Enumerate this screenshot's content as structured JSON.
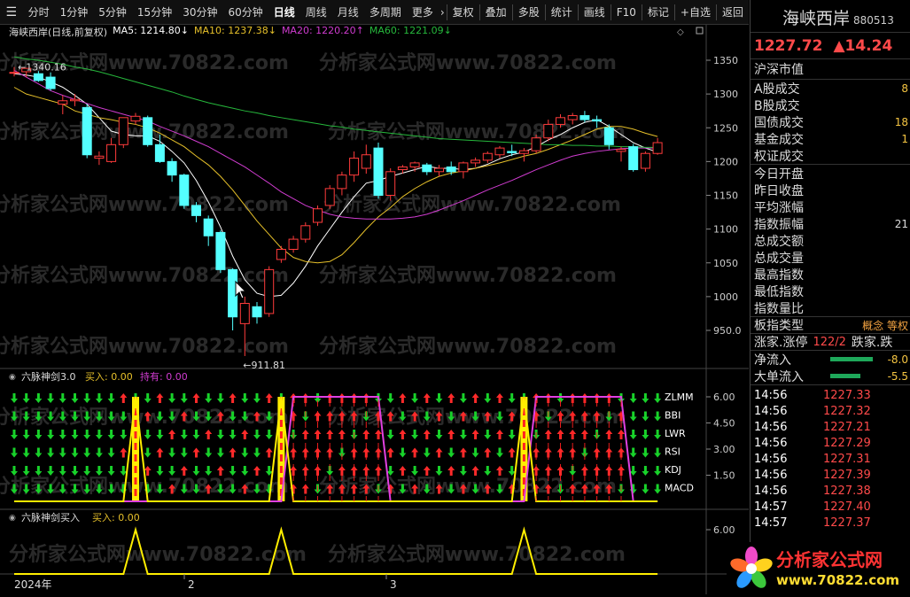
{
  "toolbar": {
    "menu_icon": "menu-icon",
    "periods": [
      "分时",
      "1分钟",
      "5分钟",
      "15分钟",
      "30分钟",
      "60分钟",
      "日线",
      "周线",
      "月线",
      "多周期",
      "更多"
    ],
    "active_period": "日线",
    "more_arrow": "›",
    "tools": [
      "复权",
      "叠加",
      "多股",
      "统计",
      "画线",
      "F10",
      "标记",
      "+自选",
      "返回"
    ]
  },
  "chart": {
    "title": "海峡西岸(日线,前复权)",
    "ma": [
      {
        "label": "MA5: 1214.80",
        "arrow": "↓",
        "color": "#ffffff"
      },
      {
        "label": "MA10: 1237.38",
        "arrow": "↓",
        "color": "#e6c02a"
      },
      {
        "label": "MA20: 1220.20",
        "arrow": "↑",
        "color": "#d03cd0"
      },
      {
        "label": "MA60: 1221.09",
        "arrow": "↓",
        "color": "#26b83c"
      }
    ],
    "high_mark": "1340.16",
    "low_mark": "911.81",
    "watermark": "分析家公式网www.70822.com",
    "y_ticks": [
      "1350",
      "1300",
      "1250",
      "1200",
      "1150",
      "1100",
      "1050",
      "1000",
      "950.0"
    ],
    "candles": [
      {
        "o": 1332,
        "h": 1340,
        "c": 1332,
        "l": 1326
      },
      {
        "o": 1333,
        "h": 1337,
        "c": 1338,
        "l": 1325
      },
      {
        "o": 1330,
        "h": 1334,
        "c": 1320,
        "l": 1318
      },
      {
        "o": 1325,
        "h": 1332,
        "c": 1308,
        "l": 1305
      },
      {
        "o": 1285,
        "h": 1298,
        "c": 1290,
        "l": 1270
      },
      {
        "o": 1290,
        "h": 1300,
        "c": 1292,
        "l": 1282
      },
      {
        "o": 1280,
        "h": 1285,
        "c": 1210,
        "l": 1205
      },
      {
        "o": 1205,
        "h": 1215,
        "c": 1208,
        "l": 1195
      },
      {
        "o": 1200,
        "h": 1235,
        "c": 1225,
        "l": 1198
      },
      {
        "o": 1225,
        "h": 1260,
        "c": 1265,
        "l": 1220
      },
      {
        "o": 1260,
        "h": 1272,
        "c": 1267,
        "l": 1255
      },
      {
        "o": 1265,
        "h": 1268,
        "c": 1225,
        "l": 1222
      },
      {
        "o": 1225,
        "h": 1240,
        "c": 1200,
        "l": 1198
      },
      {
        "o": 1200,
        "h": 1205,
        "c": 1180,
        "l": 1170
      },
      {
        "o": 1180,
        "h": 1182,
        "c": 1135,
        "l": 1130
      },
      {
        "o": 1135,
        "h": 1140,
        "c": 1120,
        "l": 1110
      },
      {
        "o": 1115,
        "h": 1120,
        "c": 1090,
        "l": 1075
      },
      {
        "o": 1095,
        "h": 1098,
        "c": 1040,
        "l": 1035
      },
      {
        "o": 1040,
        "h": 1042,
        "c": 970,
        "l": 950
      },
      {
        "o": 960,
        "h": 1000,
        "c": 990,
        "l": 912
      },
      {
        "o": 985,
        "h": 992,
        "c": 970,
        "l": 960
      },
      {
        "o": 975,
        "h": 1045,
        "c": 1040,
        "l": 970
      },
      {
        "o": 1055,
        "h": 1075,
        "c": 1070,
        "l": 1050
      },
      {
        "o": 1070,
        "h": 1090,
        "c": 1085,
        "l": 1065
      },
      {
        "o": 1085,
        "h": 1110,
        "c": 1105,
        "l": 1080
      },
      {
        "o": 1110,
        "h": 1135,
        "c": 1130,
        "l": 1105
      },
      {
        "o": 1135,
        "h": 1165,
        "c": 1160,
        "l": 1130
      },
      {
        "o": 1160,
        "h": 1185,
        "c": 1180,
        "l": 1150
      },
      {
        "o": 1180,
        "h": 1215,
        "c": 1205,
        "l": 1170
      },
      {
        "o": 1190,
        "h": 1225,
        "c": 1210,
        "l": 1182
      },
      {
        "o": 1220,
        "h": 1228,
        "c": 1150,
        "l": 1145
      },
      {
        "o": 1150,
        "h": 1190,
        "c": 1185,
        "l": 1142
      },
      {
        "o": 1188,
        "h": 1195,
        "c": 1192,
        "l": 1182
      },
      {
        "o": 1192,
        "h": 1200,
        "c": 1198,
        "l": 1185
      },
      {
        "o": 1195,
        "h": 1198,
        "c": 1185,
        "l": 1180
      },
      {
        "o": 1185,
        "h": 1195,
        "c": 1190,
        "l": 1178
      },
      {
        "o": 1192,
        "h": 1200,
        "c": 1185,
        "l": 1180
      },
      {
        "o": 1185,
        "h": 1200,
        "c": 1198,
        "l": 1175
      },
      {
        "o": 1198,
        "h": 1206,
        "c": 1202,
        "l": 1192
      },
      {
        "o": 1202,
        "h": 1215,
        "c": 1212,
        "l": 1198
      },
      {
        "o": 1210,
        "h": 1223,
        "c": 1220,
        "l": 1205
      },
      {
        "o": 1215,
        "h": 1225,
        "c": 1213,
        "l": 1208
      },
      {
        "o": 1212,
        "h": 1220,
        "c": 1216,
        "l": 1200
      },
      {
        "o": 1216,
        "h": 1240,
        "c": 1235,
        "l": 1212
      },
      {
        "o": 1235,
        "h": 1262,
        "c": 1255,
        "l": 1230
      },
      {
        "o": 1255,
        "h": 1270,
        "c": 1265,
        "l": 1250
      },
      {
        "o": 1262,
        "h": 1272,
        "c": 1268,
        "l": 1255
      },
      {
        "o": 1268,
        "h": 1275,
        "c": 1262,
        "l": 1258
      },
      {
        "o": 1262,
        "h": 1268,
        "c": 1260,
        "l": 1250
      },
      {
        "o": 1250,
        "h": 1255,
        "c": 1225,
        "l": 1218
      },
      {
        "o": 1215,
        "h": 1222,
        "c": 1218,
        "l": 1200
      },
      {
        "o": 1222,
        "h": 1226,
        "c": 1188,
        "l": 1185
      },
      {
        "o": 1190,
        "h": 1215,
        "c": 1212,
        "l": 1185
      },
      {
        "o": 1212,
        "h": 1235,
        "c": 1228,
        "l": 1210
      }
    ],
    "ma_lines": {
      "ma5": [
        1330,
        1328,
        1325,
        1318,
        1310,
        1298,
        1285,
        1265,
        1245,
        1240,
        1238,
        1238,
        1230,
        1215,
        1198,
        1172,
        1140,
        1103,
        1060,
        1025,
        1005,
        1000,
        1002,
        1020,
        1045,
        1075,
        1100,
        1125,
        1148,
        1168,
        1172,
        1178,
        1183,
        1188,
        1193,
        1190,
        1190,
        1188,
        1190,
        1196,
        1204,
        1210,
        1214,
        1222,
        1232,
        1240,
        1250,
        1258,
        1262,
        1252,
        1240,
        1228,
        1220,
        1214
      ],
      "ma10": [
        1310,
        1300,
        1295,
        1290,
        1285,
        1275,
        1270,
        1265,
        1262,
        1258,
        1255,
        1250,
        1242,
        1232,
        1222,
        1208,
        1195,
        1178,
        1158,
        1135,
        1112,
        1092,
        1072,
        1058,
        1052,
        1050,
        1052,
        1062,
        1080,
        1100,
        1118,
        1132,
        1148,
        1160,
        1170,
        1178,
        1183,
        1186,
        1190,
        1194,
        1198,
        1203,
        1208,
        1212,
        1218,
        1225,
        1232,
        1240,
        1248,
        1252,
        1252,
        1248,
        1242,
        1237
      ],
      "ma20": [
        1335,
        1325,
        1315,
        1305,
        1298,
        1292,
        1286,
        1280,
        1275,
        1270,
        1265,
        1260,
        1252,
        1245,
        1238,
        1230,
        1222,
        1212,
        1202,
        1192,
        1180,
        1168,
        1155,
        1145,
        1135,
        1128,
        1122,
        1118,
        1116,
        1115,
        1115,
        1115,
        1116,
        1118,
        1122,
        1128,
        1135,
        1142,
        1150,
        1158,
        1165,
        1172,
        1180,
        1188,
        1195,
        1202,
        1208,
        1212,
        1215,
        1217,
        1219,
        1220,
        1220,
        1220
      ],
      "ma60": [
        1355,
        1352,
        1350,
        1347,
        1344,
        1340,
        1337,
        1333,
        1328,
        1323,
        1318,
        1313,
        1308,
        1303,
        1297,
        1292,
        1287,
        1283,
        1279,
        1275,
        1272,
        1268,
        1265,
        1262,
        1259,
        1256,
        1253,
        1251,
        1248,
        1246,
        1244,
        1242,
        1240,
        1238,
        1236,
        1234,
        1233,
        1232,
        1231,
        1230,
        1229,
        1228,
        1227,
        1226,
        1225,
        1225,
        1224,
        1224,
        1223,
        1223,
        1222,
        1222,
        1221,
        1221
      ]
    }
  },
  "indicator1": {
    "title": "六脉神剑3.0",
    "buy_label": "买入: 0.00",
    "hold_label": "持有: 0.00",
    "rows": [
      "ZLMM",
      "BBI",
      "LWR",
      "RSI",
      "KDJ",
      "MACD"
    ],
    "y_ticks": [
      "6.00",
      "4.50",
      "3.00",
      "1.50"
    ],
    "hold_level": [
      0,
      0,
      0,
      0,
      0,
      0,
      0,
      0,
      0,
      0,
      0,
      0,
      0,
      0,
      0,
      0,
      0,
      0,
      0,
      0,
      0,
      0,
      0,
      6,
      6,
      6,
      6,
      6,
      6,
      6,
      6,
      0,
      0,
      0,
      0,
      0,
      0,
      0,
      0,
      0,
      0,
      0,
      0,
      6,
      6,
      6,
      6,
      6,
      6,
      6,
      6,
      0,
      0,
      0
    ],
    "spike_index": [
      10,
      22,
      42
    ]
  },
  "indicator2": {
    "title": "六脉神剑买入",
    "buy_label": "买入: 0.00",
    "y_ticks": [
      "6.00"
    ],
    "spike_index": [
      10,
      22,
      42
    ]
  },
  "xaxis": {
    "labels": [
      "2024年",
      "2",
      "3"
    ]
  },
  "sidebar": {
    "name": "海峡西岸",
    "code": "880513",
    "price": "1227.72",
    "change": "▲14.24",
    "section": "沪深市值",
    "rows": [
      {
        "k": "A股成交",
        "v": "8"
      },
      {
        "k": "B股成交",
        "v": ""
      },
      {
        "k": "国债成交",
        "v": "18"
      },
      {
        "k": "基金成交",
        "v": "1"
      },
      {
        "k": "权证成交",
        "v": ""
      }
    ],
    "rows2": [
      {
        "k": "今日开盘",
        "v": ""
      },
      {
        "k": "昨日收盘",
        "v": ""
      },
      {
        "k": "平均涨幅",
        "v": ""
      },
      {
        "k": "指数振幅",
        "v": "21"
      },
      {
        "k": "总成交额",
        "v": ""
      },
      {
        "k": "总成交量",
        "v": ""
      },
      {
        "k": "最高指数",
        "v": ""
      },
      {
        "k": "最低指数",
        "v": ""
      },
      {
        "k": "指数量比",
        "v": ""
      }
    ],
    "board_type": {
      "k": "板指类型",
      "v": "概念 等权"
    },
    "updown": {
      "k": "涨家.涨停",
      "v": "122/2",
      "k2": "跌家.跌"
    },
    "flows": [
      {
        "k": "净流入",
        "v": "-8.0"
      },
      {
        "k": "大单流入",
        "v": "-5.5"
      }
    ],
    "ticks": [
      {
        "t": "14:56",
        "p": "1227.33"
      },
      {
        "t": "14:56",
        "p": "1227.32"
      },
      {
        "t": "14:56",
        "p": "1227.21"
      },
      {
        "t": "14:56",
        "p": "1227.29"
      },
      {
        "t": "14:56",
        "p": "1227.31"
      },
      {
        "t": "14:56",
        "p": "1227.39"
      },
      {
        "t": "14:56",
        "p": "1227.38"
      },
      {
        "t": "14:57",
        "p": "1227.40"
      },
      {
        "t": "14:57",
        "p": "1227.37"
      }
    ]
  },
  "logo": {
    "text": "分析家公式网",
    "url": "www.70822.com"
  }
}
